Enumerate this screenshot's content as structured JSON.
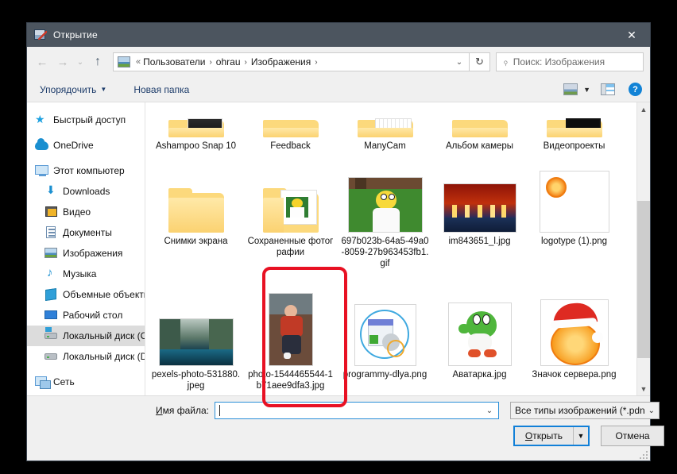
{
  "window": {
    "title": "Открытие",
    "title_icon": "paint-picture-icon",
    "close_label": "✕"
  },
  "nav": {
    "back_icon": "←",
    "forward_icon": "→",
    "history_icon": "⌄",
    "up_icon": "↑",
    "refresh_icon": "↻",
    "breadcrumb_icon": "pictures-icon",
    "breadcrumb_prefix": "«",
    "breadcrumb": [
      "Пользователи",
      "ohrau",
      "Изображения"
    ],
    "breadcrumb_separator": "›",
    "dropdown_icon": "⌄"
  },
  "search": {
    "placeholder": "Поиск: Изображения",
    "icon": "search-icon"
  },
  "commandbar": {
    "organize_label": "Упорядочить",
    "organize_caret": "▼",
    "new_folder_label": "Новая папка",
    "view_icon": "view-layout-icon",
    "view_caret": "▼",
    "preview_pane_icon": "preview-pane-icon",
    "help_label": "?"
  },
  "sidebar": {
    "items": [
      {
        "label": "Быстрый доступ",
        "icon": "star-icon",
        "indent": false,
        "selected": false
      },
      {
        "label": "OneDrive",
        "icon": "cloud-icon",
        "indent": false,
        "selected": false
      },
      {
        "label": "Этот компьютер",
        "icon": "computer-icon",
        "indent": false,
        "selected": false
      },
      {
        "label": "Downloads",
        "icon": "download-icon",
        "indent": true,
        "selected": false
      },
      {
        "label": "Видео",
        "icon": "video-icon",
        "indent": true,
        "selected": false
      },
      {
        "label": "Документы",
        "icon": "documents-icon",
        "indent": true,
        "selected": false
      },
      {
        "label": "Изображения",
        "icon": "pictures-icon",
        "indent": true,
        "selected": false
      },
      {
        "label": "Музыка",
        "icon": "music-icon",
        "indent": true,
        "selected": false
      },
      {
        "label": "Объемные объекты",
        "icon": "3d-objects-icon",
        "indent": true,
        "selected": false
      },
      {
        "label": "Рабочий стол",
        "icon": "desktop-icon",
        "indent": true,
        "selected": false
      },
      {
        "label": "Локальный диск (C",
        "icon": "windows-disk-icon",
        "indent": true,
        "selected": true
      },
      {
        "label": "Локальный диск (D",
        "icon": "disk-icon",
        "indent": true,
        "selected": false
      },
      {
        "label": "Сеть",
        "icon": "network-icon",
        "indent": false,
        "selected": false
      }
    ]
  },
  "files": {
    "row_partial": [
      {
        "name": "Ashampoo Snap 10",
        "type": "folder"
      },
      {
        "name": "Feedback",
        "type": "folder"
      },
      {
        "name": "ManyCam",
        "type": "folder"
      },
      {
        "name": "Альбом камеры",
        "type": "folder"
      },
      {
        "name": "Видеопроекты",
        "type": "folder"
      }
    ],
    "row_two": [
      {
        "name": "Снимки экрана",
        "type": "folder"
      },
      {
        "name": "Сохраненные фотографии",
        "type": "folder-preview"
      },
      {
        "name": "697b023b-64a5-49a0-8059-27b963453fb1.gif",
        "type": "image-homer"
      },
      {
        "name": "im843651_l.jpg",
        "type": "image-city"
      },
      {
        "name": "logotype (1).png",
        "type": "image-orange-logo"
      }
    ],
    "row_three": [
      {
        "name": "pexels-photo-531880.jpeg",
        "type": "image-forest"
      },
      {
        "name": "photo-1544465544-1b71aee9dfa3.jpg",
        "type": "image-girl",
        "highlighted": true
      },
      {
        "name": "programmy-dlya.png",
        "type": "image-software"
      },
      {
        "name": "Аватарка.jpg",
        "type": "image-yoshi"
      },
      {
        "name": "Значок сервера.png",
        "type": "image-orange-santa"
      }
    ]
  },
  "scrollbar": {
    "up_icon": "▲",
    "down_icon": "▼"
  },
  "footer": {
    "filename_label_pre": "И",
    "filename_label_post": "мя файла:",
    "filename_value": "",
    "filename_dropdown_icon": "⌄",
    "filetype_value": "Все типы изображений (*.pdn",
    "filetype_caret": "⌄",
    "open_label_pre": "О",
    "open_label_post": "ткрыть",
    "open_caret": "▼",
    "cancel_label": "Отмена"
  },
  "annotation": {
    "highlight_color": "#e81123",
    "highlights_item": "photo-1544465544-1b71aee9dfa3.jpg"
  }
}
